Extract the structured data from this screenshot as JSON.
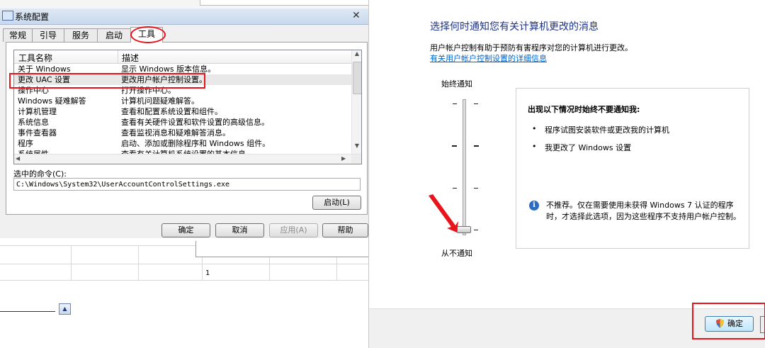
{
  "left_window": {
    "title": "系统配置",
    "tabs": [
      {
        "label": "常规"
      },
      {
        "label": "引导"
      },
      {
        "label": "服务"
      },
      {
        "label": "启动"
      },
      {
        "label": "工具"
      }
    ],
    "active_tab": "工具",
    "columns": [
      "工具名称",
      "描述"
    ],
    "tools": [
      {
        "name": "关于 Windows",
        "desc": "显示 Windows 版本信息。"
      },
      {
        "name": "更改 UAC 设置",
        "desc": "更改用户帐户控制设置。"
      },
      {
        "name": "操作中心",
        "desc": "打开操作中心。"
      },
      {
        "name": "Windows 疑难解答",
        "desc": "计算机问题疑难解答。"
      },
      {
        "name": "计算机管理",
        "desc": "查看和配置系统设置和组件。"
      },
      {
        "name": "系统信息",
        "desc": "查看有关硬件设置和软件设置的高级信息。"
      },
      {
        "name": "事件查看器",
        "desc": "查看监视消息和疑难解答消息。"
      },
      {
        "name": "程序",
        "desc": "启动、添加或删除程序和 Windows 组件。"
      },
      {
        "name": "系统属性",
        "desc": "查看有关计算机系统设置的基本信息。"
      }
    ],
    "selected_tool": "更改 UAC 设置",
    "command_label": "选中的命令(C):",
    "command_value": "C:\\Windows\\System32\\UserAccountControlSettings.exe",
    "launch_button": "启动(L)",
    "ok_button": "确定",
    "cancel_button": "取消",
    "apply_button": "应用(A)",
    "help_button": "帮助",
    "below_cell_value": "1"
  },
  "uac_window": {
    "heading": "选择何时通知您有关计算机更改的消息",
    "description": "用户帐户控制有助于预防有害程序对您的计算机进行更改。",
    "link": "有关用户帐户控制设置的详细信息",
    "slider_top_label": "始终通知",
    "slider_bottom_label": "从不通知",
    "slider_level": 0,
    "slider_levels": 4,
    "info_heading": "出现以下情况时始终不要通知我:",
    "bullets": [
      "程序试图安装软件或更改我的计算机",
      "我更改了 Windows 设置"
    ],
    "warning": "不推荐。仅在需要使用未获得 Windows 7 认证的程序时，才选择此选项，因为这些程序不支持用户帐户控制。",
    "ok_button": "确定"
  },
  "colors": {
    "highlight": "#e8141c",
    "heading_blue": "#1e3287",
    "link_blue": "#0066cc",
    "info_blue": "#2b6cc4"
  },
  "icons": [
    "app-icon",
    "close-icon",
    "shield-icon",
    "info-icon",
    "arrow-annotation-icon"
  ]
}
